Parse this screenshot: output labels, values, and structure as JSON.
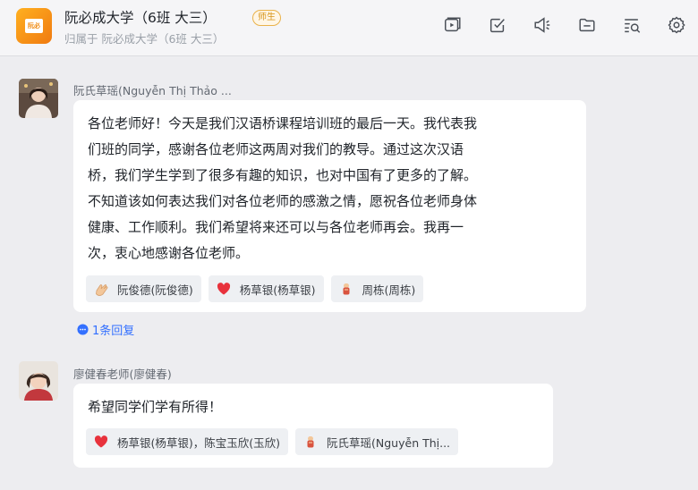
{
  "header": {
    "title": "阮必成大学（6班 大三）",
    "badge": "师生",
    "subtitle": "归属于 阮必成大学（6班 大三）",
    "logo_text": "阮必",
    "tools": [
      "video-icon",
      "task-check-icon",
      "announcement-icon",
      "folder-icon",
      "search-list-icon",
      "settings-gear-icon"
    ]
  },
  "messages": [
    {
      "sender": "阮氏草瑶(Nguyễn Thị Thảo ...",
      "lines": [
        "各位老师好！今天是我们汉语桥课程培训班的最后一天。我代表我",
        "们班的同学，感谢各位老师这两周对我们的教导。通过这次汉语",
        "桥，我们学生学到了很多有趣的知识，也对中国有了更多的了解。",
        "不知道该如何表达我们对各位老师的感激之情，愿祝各位老师身体",
        "健康、工作顺利。我们希望将来还可以与各位老师再会。我再一",
        "次，衷心地感谢各位老师。"
      ],
      "reactions": [
        {
          "icon": "clapping-hands-icon",
          "names": "阮俊德(阮俊德)"
        },
        {
          "icon": "red-heart-icon",
          "names": "杨草银(杨草银)"
        },
        {
          "icon": "thumbs-up-icon",
          "names": "周栋(周栋)"
        }
      ],
      "replies": "1条回复"
    },
    {
      "sender": "廖健春老师(廖健春)",
      "lines": [
        "希望同学们学有所得！"
      ],
      "reactions": [
        {
          "icon": "red-heart-icon",
          "names": "杨草银(杨草银)，陈宝玉欣(玉欣)"
        },
        {
          "icon": "thumbs-up-icon",
          "names": "阮氏草瑶(Nguyễn Thị..."
        }
      ]
    }
  ],
  "colors": {
    "accent": "#3370ff",
    "logo": "#f5901a",
    "heart": "#e8323c",
    "badge": "#d7951b"
  }
}
